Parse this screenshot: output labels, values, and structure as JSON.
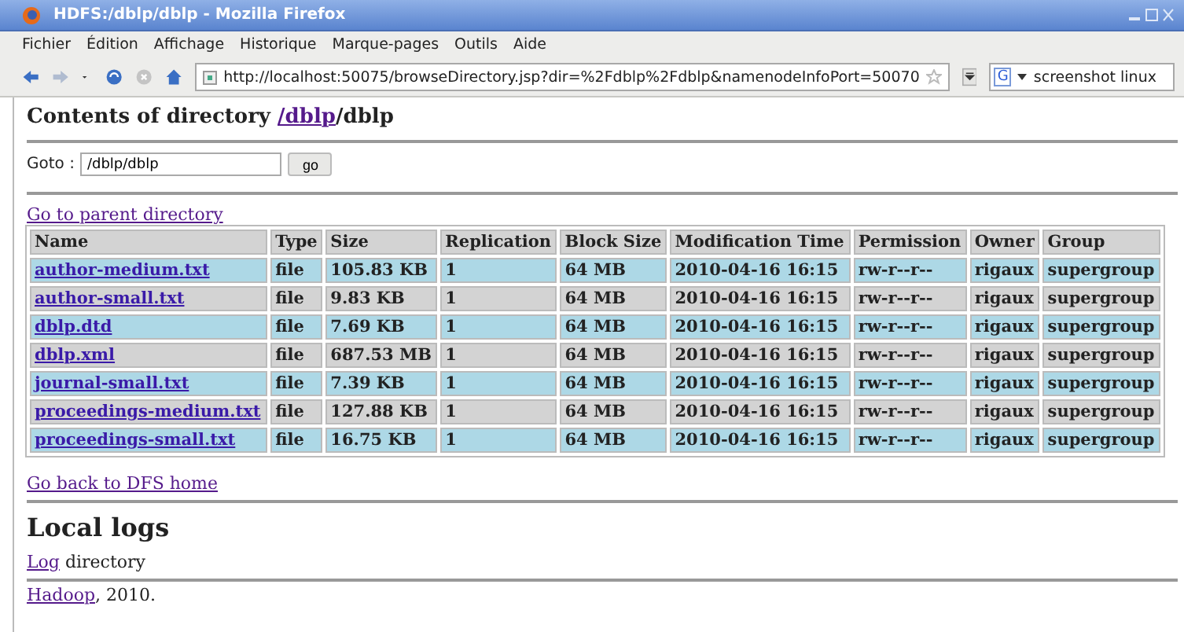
{
  "window": {
    "title": "HDFS:/dblp/dblp - Mozilla Firefox"
  },
  "menu": [
    "Fichier",
    "Édition",
    "Affichage",
    "Historique",
    "Marque-pages",
    "Outils",
    "Aide"
  ],
  "address_bar": {
    "value": "http://localhost:50075/browseDirectory.jsp?dir=%2Fdblp%2Fdblp&namenodeInfoPort=50070"
  },
  "search": {
    "engine": "G",
    "value": "screenshot linux"
  },
  "heading": {
    "prefix": "Contents of directory ",
    "link": "/dblp",
    "rest": "/dblp"
  },
  "goto": {
    "label": "Goto :",
    "value": "/dblp/dblp",
    "button": "go"
  },
  "parent_link": "Go to parent directory",
  "table": {
    "columns": [
      "Name",
      "Type",
      "Size",
      "Replication",
      "Block Size",
      "Modification Time",
      "Permission",
      "Owner",
      "Group"
    ],
    "rows": [
      [
        "author-medium.txt",
        "file",
        "105.83 KB",
        "1",
        "64 MB",
        "2010-04-16 16:15",
        "rw-r--r--",
        "rigaux",
        "supergroup"
      ],
      [
        "author-small.txt",
        "file",
        "9.83 KB",
        "1",
        "64 MB",
        "2010-04-16 16:15",
        "rw-r--r--",
        "rigaux",
        "supergroup"
      ],
      [
        "dblp.dtd",
        "file",
        "7.69 KB",
        "1",
        "64 MB",
        "2010-04-16 16:15",
        "rw-r--r--",
        "rigaux",
        "supergroup"
      ],
      [
        "dblp.xml",
        "file",
        "687.53 MB",
        "1",
        "64 MB",
        "2010-04-16 16:15",
        "rw-r--r--",
        "rigaux",
        "supergroup"
      ],
      [
        "journal-small.txt",
        "file",
        "7.39 KB",
        "1",
        "64 MB",
        "2010-04-16 16:15",
        "rw-r--r--",
        "rigaux",
        "supergroup"
      ],
      [
        "proceedings-medium.txt",
        "file",
        "127.88 KB",
        "1",
        "64 MB",
        "2010-04-16 16:15",
        "rw-r--r--",
        "rigaux",
        "supergroup"
      ],
      [
        "proceedings-small.txt",
        "file",
        "16.75 KB",
        "1",
        "64 MB",
        "2010-04-16 16:15",
        "rw-r--r--",
        "rigaux",
        "supergroup"
      ]
    ]
  },
  "home_link": "Go back to DFS home",
  "logs": {
    "title": "Local logs",
    "link": "Log",
    "text": " directory"
  },
  "footer": {
    "link": "Hadoop",
    "text": ", 2010."
  }
}
